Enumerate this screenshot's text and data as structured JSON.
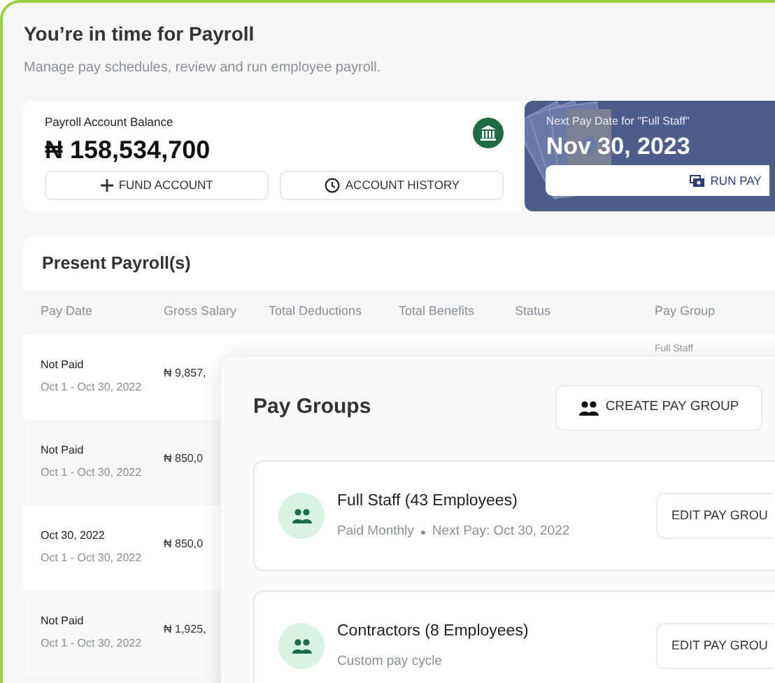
{
  "header": {
    "title": "You’re in time for Payroll",
    "subtitle": "Manage pay schedules, review and run employee payroll."
  },
  "balance_card": {
    "label": "Payroll Account Balance",
    "amount": "₦ 158,534,700",
    "buttons": [
      {
        "kind": "plus",
        "label": "FUND ACCOUNT"
      },
      {
        "kind": "clock",
        "label": "ACCOUNT HISTORY"
      }
    ]
  },
  "next_pay_card": {
    "label": "Next Pay Date for \"Full Staff\"",
    "date": "Nov 30, 2023",
    "button": "RUN PAY"
  },
  "payroll_table": {
    "title": "Present Payroll(s)",
    "columns": [
      "Pay Date",
      "Gross Salary",
      "Total Deductions",
      "Total Benefits",
      "Status",
      "Pay Group"
    ],
    "rows": [
      {
        "pay_date": "Not Paid",
        "period": "Oct 1 - Oct 30, 2022",
        "gross_salary": "₦ 9,857,",
        "pay_group": "Full Staff"
      },
      {
        "pay_date": "Not Paid",
        "period": "Oct 1 - Oct 30, 2022",
        "gross_salary": "₦ 850,0"
      },
      {
        "pay_date": "Oct 30, 2022",
        "period": "Oct 1 - Oct 30, 2022",
        "gross_salary": "₦ 850,0"
      },
      {
        "pay_date": "Not Paid",
        "period": "Oct 1 - Oct 30, 2022",
        "gross_salary": "₦ 1,925,"
      }
    ]
  },
  "pay_groups": {
    "title": "Pay Groups",
    "create_button": "CREATE PAY GROUP",
    "groups": [
      {
        "name": "Full Staff (43 Employees)",
        "details": [
          "Paid Monthly",
          "Next Pay: Oct 30, 2022"
        ],
        "button": "EDIT PAY GROU"
      },
      {
        "name": "Contractors (8 Employees)",
        "details": [
          "Custom pay cycle"
        ],
        "button": "EDIT PAY GROU"
      }
    ]
  }
}
